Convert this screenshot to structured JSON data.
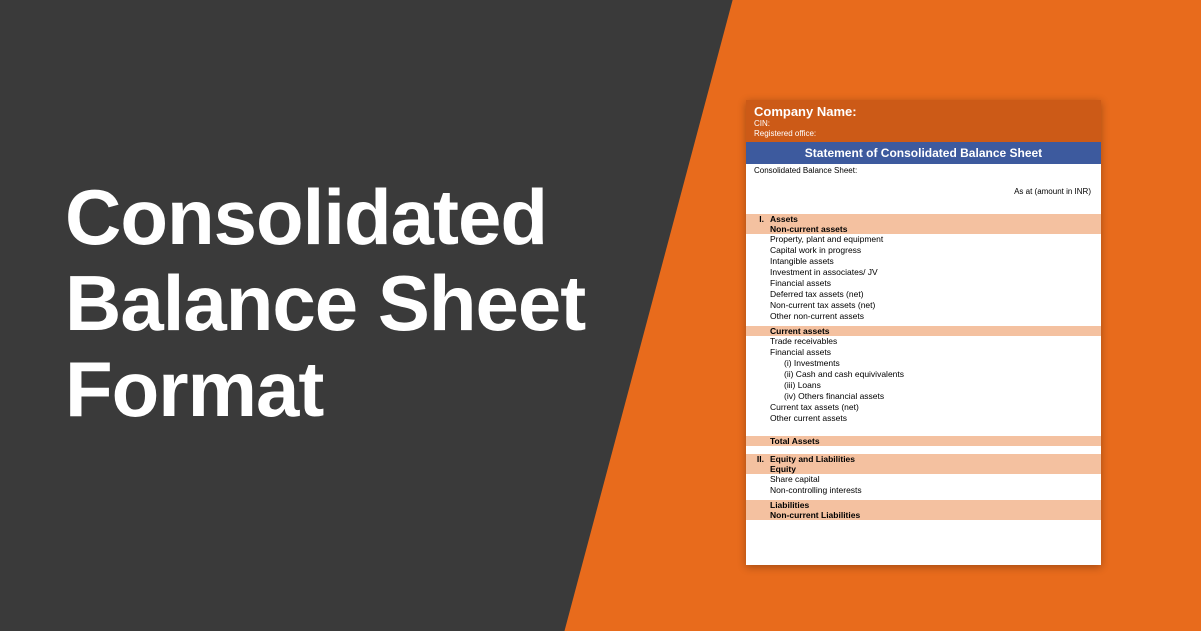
{
  "heading_line1": "Consolidated",
  "heading_line2": "Balance Sheet",
  "heading_line3": "Format",
  "sheet": {
    "company_label": "Company Name:",
    "cin_label": "CIN:",
    "reg_label": "Registered office:",
    "title": "Statement of Consolidated Balance Sheet",
    "cbs_label": "Consolidated Balance Sheet:",
    "asat_label": "As at (amount in INR)",
    "section1_num": "I.",
    "assets_heading": "Assets",
    "noncurrent_assets": "Non-current assets",
    "ppe": "Property, plant and equipment",
    "cwip": "Capital work in progress",
    "intangible": "Intangible assets",
    "invest_assoc": "Investment in associates/ JV",
    "fin_assets1": "Financial assets",
    "def_tax": "Deferred tax assets (net)",
    "nc_tax": "Non-current tax assets (net)",
    "other_nc": "Other non-current assets",
    "current_assets": "Current assets",
    "trade_recv": "Trade receivables",
    "fin_assets2": "Financial assets",
    "i_invest": "(i) Investments",
    "ii_cash": "(ii) Cash and cash equivivalents",
    "iii_loans": "(iii) Loans",
    "iv_others": "(iv) Others financial assets",
    "cur_tax": "Current tax assets (net)",
    "other_cur": "Other current assets",
    "total_assets": "Total Assets",
    "section2_num": "II.",
    "eq_liab": "Equity and Liabilities",
    "equity": "Equity",
    "share_cap": "Share capital",
    "nci": "Non-controlling interests",
    "liabilities": "Liabilities",
    "nc_liabilities": "Non-current Liabilities"
  }
}
